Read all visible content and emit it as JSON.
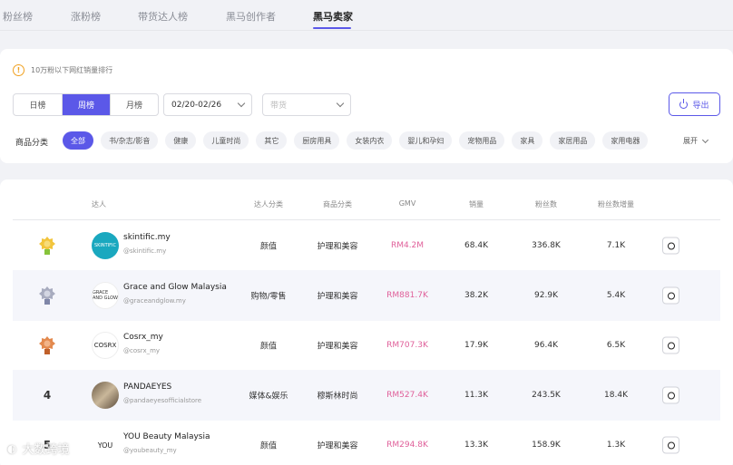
{
  "tabs": [
    "粉丝榜",
    "涨粉榜",
    "带货达人榜",
    "黑马创作者",
    "黑马卖家"
  ],
  "active_tab": "黑马卖家",
  "filters": {
    "notice": "10万粉以下网红销量排行",
    "periods": [
      "日榜",
      "周榜",
      "月榜"
    ],
    "active_period": "周榜",
    "date_range": "02/20-02/26",
    "type_placeholder": "带货",
    "export_label": "导出",
    "category_label": "商品分类",
    "categories": [
      "全部",
      "书/杂志/影音",
      "健康",
      "儿童时尚",
      "其它",
      "厨房用具",
      "女装内衣",
      "婴儿和孕妇",
      "宠物用品",
      "家具",
      "家居用品",
      "家用电器"
    ],
    "expand_label": "展开"
  },
  "table": {
    "headers": [
      "达人",
      "达人分类",
      "商品分类",
      "GMV",
      "销量",
      "粉丝数",
      "粉丝数增量"
    ],
    "rows": [
      {
        "rank": "1",
        "name": "skintific.my",
        "handle": "@skintific.my",
        "avatar_text": "SKINTIFIC",
        "creator_category": "颜值",
        "product_category": "护理和美容",
        "gmv": "RM4.2M",
        "sales": "68.4K",
        "followers": "336.8K",
        "follower_growth": "7.1K"
      },
      {
        "rank": "2",
        "name": "Grace and Glow Malaysia",
        "handle": "@graceandglow.my",
        "avatar_text": "GRACE AND GLOW",
        "creator_category": "购物/零售",
        "product_category": "护理和美容",
        "gmv": "RM881.7K",
        "sales": "38.2K",
        "followers": "92.9K",
        "follower_growth": "5.4K"
      },
      {
        "rank": "3",
        "name": "Cosrx_my",
        "handle": "@cosrx_my",
        "avatar_text": "COSRX",
        "creator_category": "颜值",
        "product_category": "护理和美容",
        "gmv": "RM707.3K",
        "sales": "17.9K",
        "followers": "96.4K",
        "follower_growth": "6.5K"
      },
      {
        "rank": "4",
        "name": "PANDAEYES",
        "handle": "@pandaeyesofficialstore",
        "avatar_text": "",
        "creator_category": "媒体&娱乐",
        "product_category": "穆斯林时尚",
        "gmv": "RM527.4K",
        "sales": "11.3K",
        "followers": "243.5K",
        "follower_growth": "18.4K"
      },
      {
        "rank": "5",
        "name": "YOU Beauty Malaysia",
        "handle": "@youbeauty_my",
        "avatar_text": "YOU",
        "creator_category": "颜值",
        "product_category": "护理和美容",
        "gmv": "RM294.8K",
        "sales": "13.3K",
        "followers": "158.9K",
        "follower_growth": "1.3K"
      }
    ]
  },
  "watermark": "大数跨境",
  "colors": {
    "accent": "#5b58e8",
    "gmv": "#e0609a",
    "gold": "#f2c53d",
    "silver": "#a8acbf",
    "bronze": "#e38a4f"
  }
}
